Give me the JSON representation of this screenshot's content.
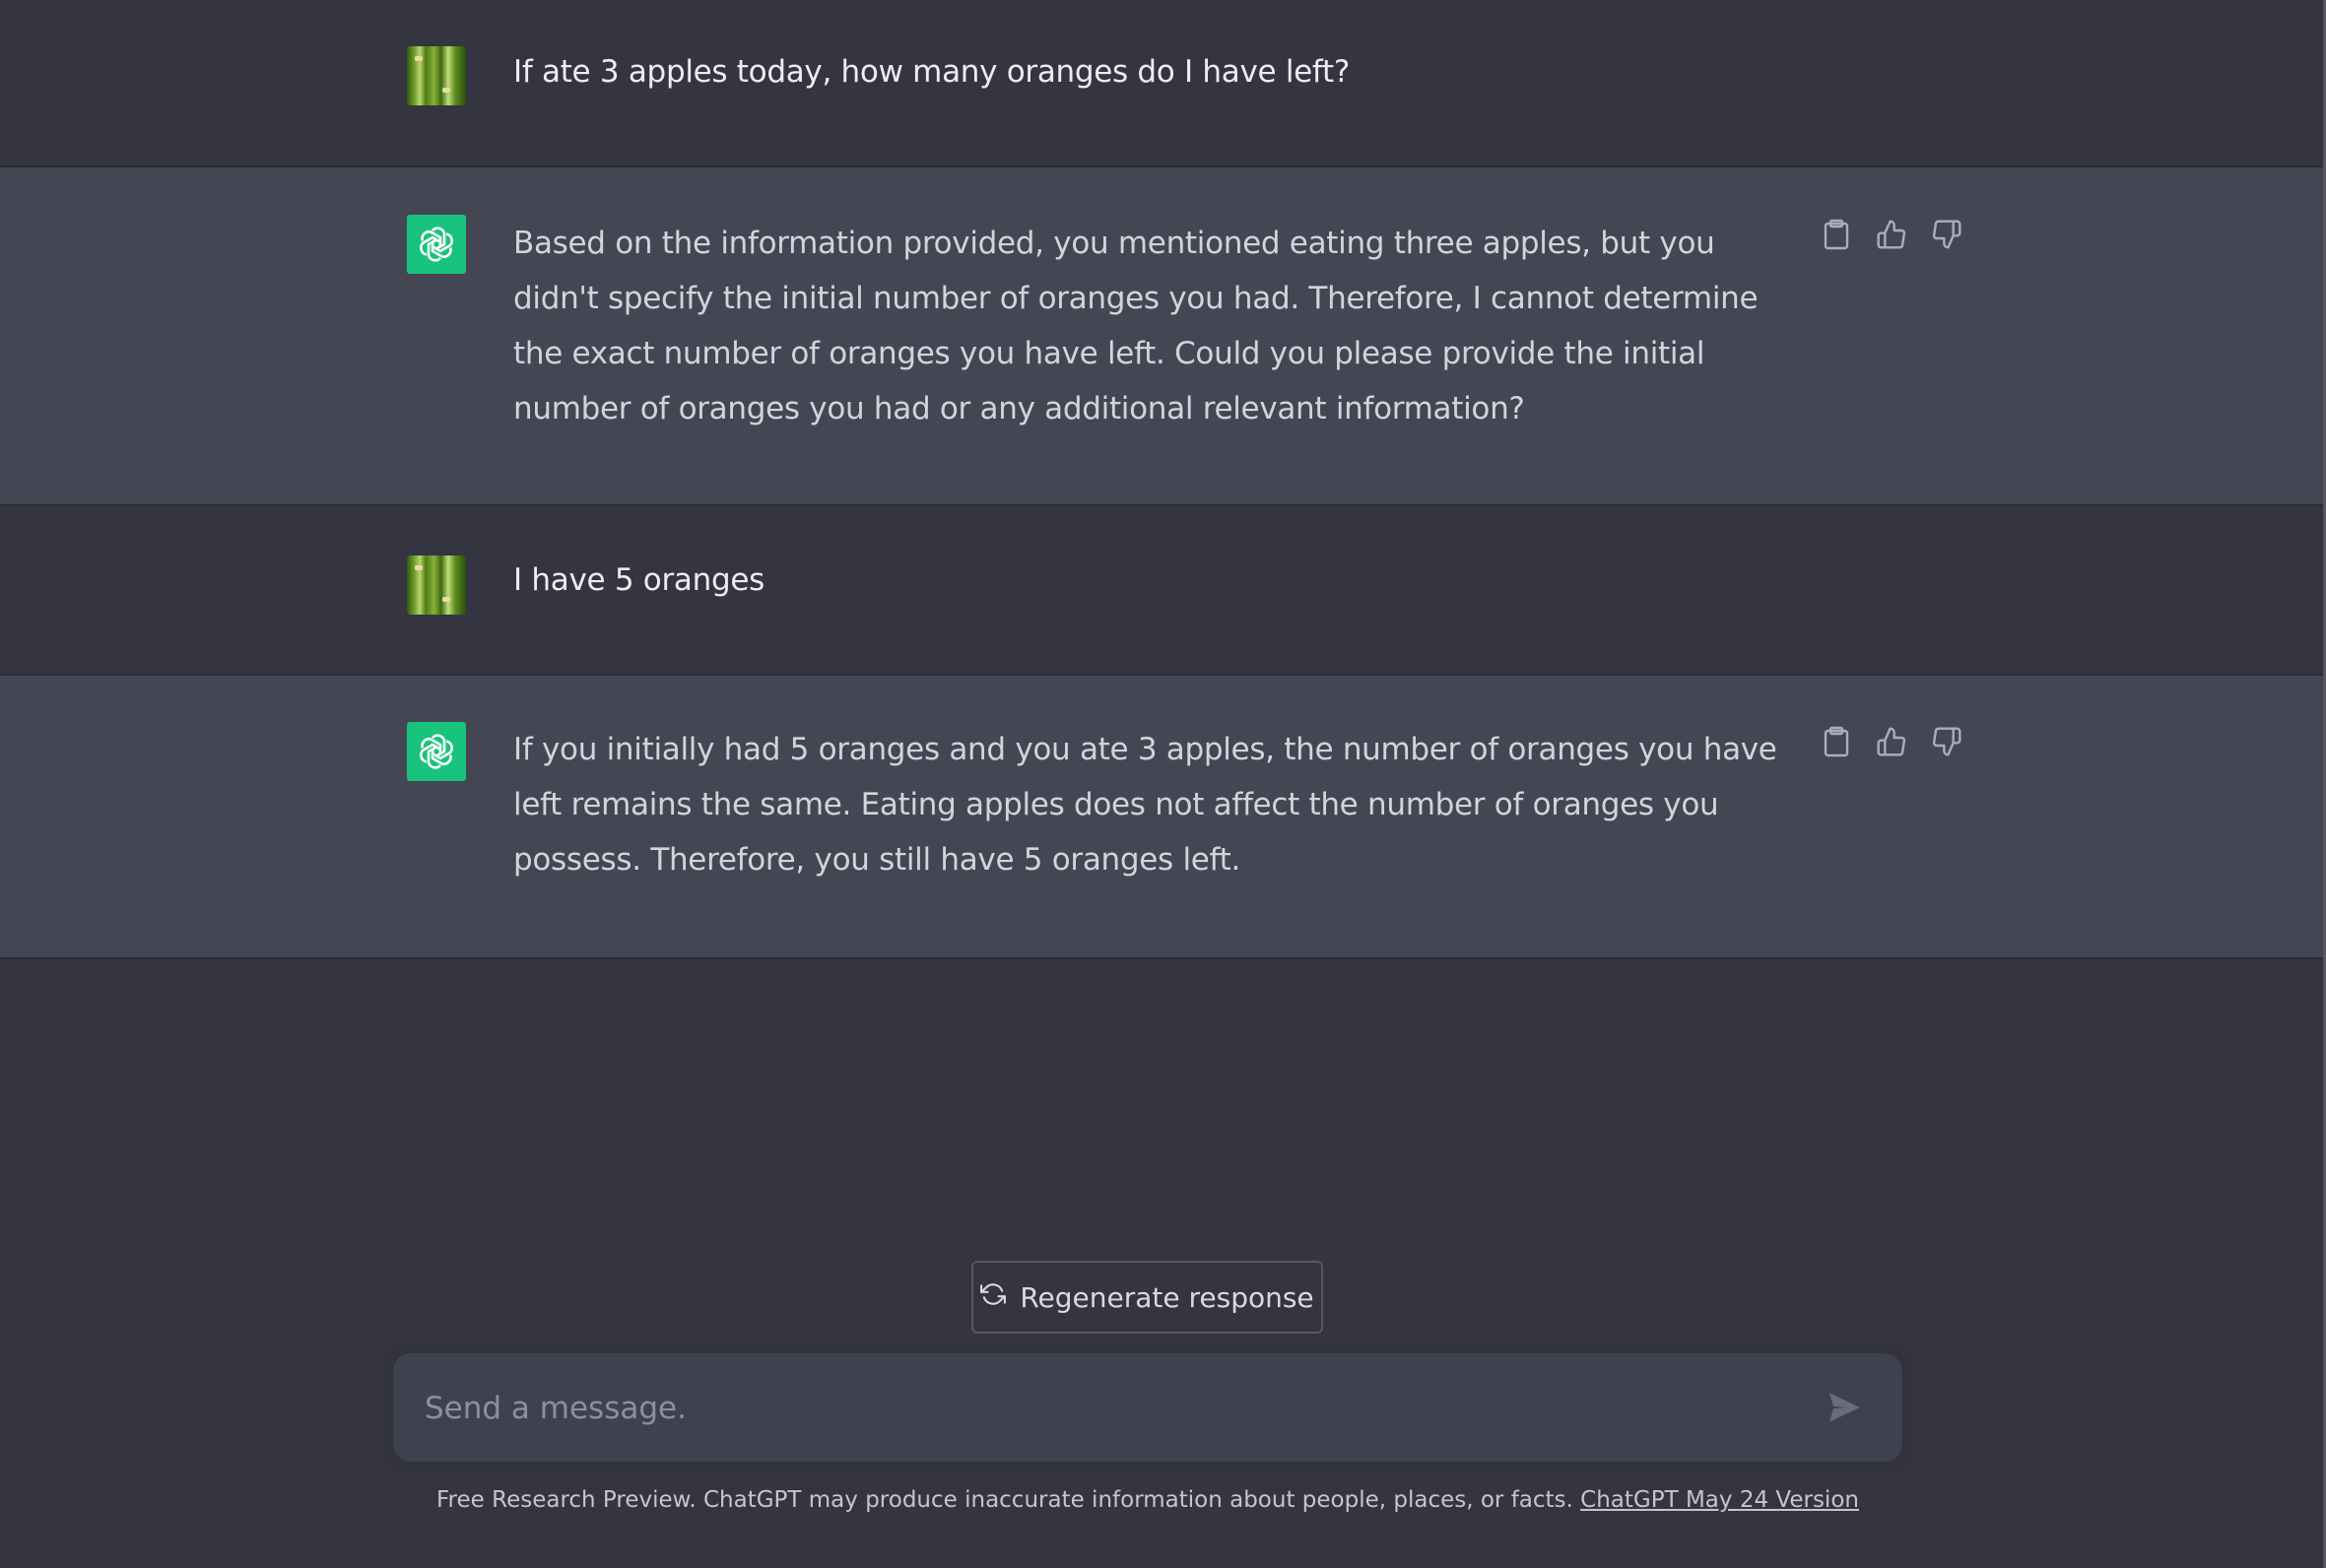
{
  "conversation": [
    {
      "role": "user",
      "avatar": "user-bamboo-avatar",
      "text": "If ate 3 apples today, how many oranges do I have left?"
    },
    {
      "role": "assistant",
      "avatar": "chatgpt-logo-icon",
      "text": "Based on the information provided, you mentioned eating three apples, but you didn't specify the initial number of oranges you had. Therefore, I cannot determine the exact number of oranges you have left. Could you please provide the initial number of oranges you had or any additional relevant information?"
    },
    {
      "role": "user",
      "avatar": "user-bamboo-avatar",
      "text": "I have 5 oranges"
    },
    {
      "role": "assistant",
      "avatar": "chatgpt-logo-icon",
      "text": "If you initially had 5 oranges and you ate 3 apples, the number of oranges you have left remains the same. Eating apples does not affect the number of oranges you possess. Therefore, you still have 5 oranges left."
    }
  ],
  "message_actions": {
    "icons": [
      "clipboard-icon",
      "thumbs-up-icon",
      "thumbs-down-icon"
    ]
  },
  "regenerate": {
    "label": "Regenerate response",
    "icon": "refresh-icon"
  },
  "composer": {
    "placeholder": "Send a message.",
    "value": "",
    "send_icon": "send-icon"
  },
  "footer": {
    "text": "Free Research Preview. ChatGPT may produce inaccurate information about people, places, or facts.",
    "link_label": "ChatGPT May 24 Version"
  },
  "colors": {
    "background": "#343541",
    "assistant_background": "#444654",
    "composer_background": "#40414f",
    "gpt_accent": "#19c37d",
    "text_primary": "#ececf1",
    "text_secondary": "#d1d5db"
  }
}
